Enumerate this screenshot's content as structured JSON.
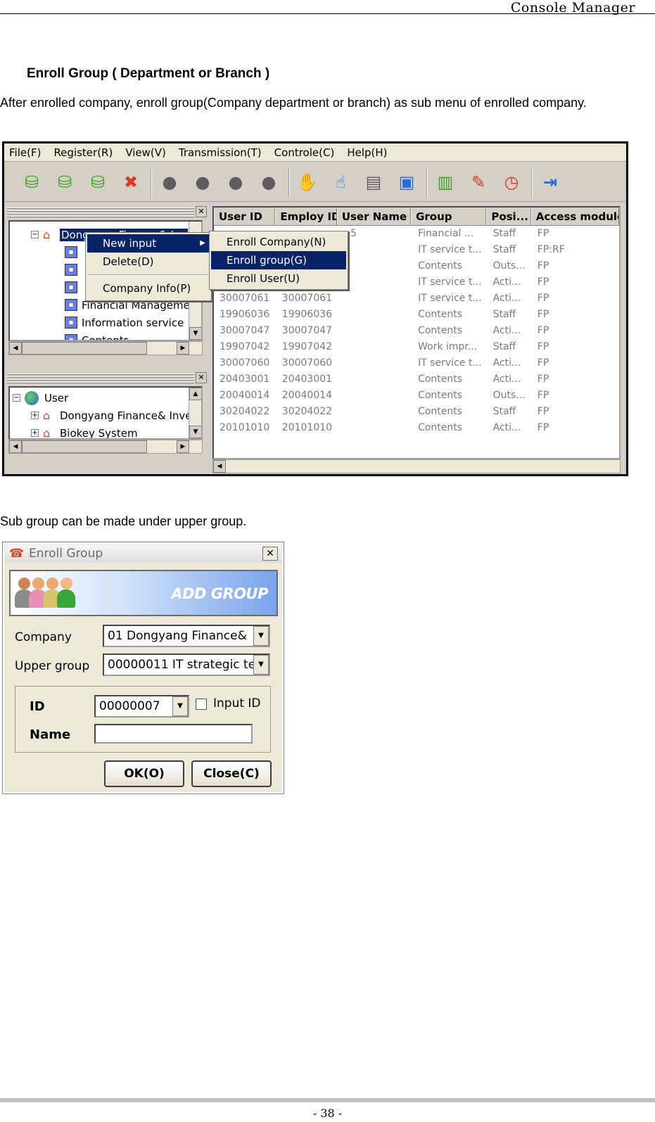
{
  "header": {
    "title": "Console Manager"
  },
  "section": {
    "heading": "Enroll Group ( Department or Branch )",
    "intro": "After enrolled company, enroll group(Company department or branch) as sub menu of enrolled company.",
    "subtext": "Sub group can be made under upper group."
  },
  "console": {
    "menu": [
      "File(F)",
      "Register(R)",
      "View(V)",
      "Transmission(T)",
      "Controle(C)",
      "Help(H)"
    ],
    "toolbar_icons": [
      "database-add-icon",
      "database-delete-icon",
      "database-info-icon",
      "delete-icon",
      "user-icon",
      "user-add-icon",
      "users-icon",
      "users-group-icon",
      "hand-icon",
      "finger-icon",
      "card-icon",
      "rf-icon",
      "monitor-icon",
      "edit-icon",
      "clock-icon",
      "exit-icon"
    ],
    "tree_top": {
      "rows": [
        "Dongyang Finance& Inv",
        "",
        "",
        "",
        "Financial Manageme",
        "Information service",
        "Contents"
      ]
    },
    "tree_bottom": {
      "rows": [
        "User",
        "Dongyang Finance& Inve",
        "Biokey System"
      ]
    },
    "grid": {
      "columns": [
        "User ID",
        "Employ ID",
        "User Name",
        "Group",
        "Posi...",
        "Access module"
      ],
      "rows": [
        [
          "",
          "",
          "e5",
          "Financial ...",
          "Staff",
          "FP"
        ],
        [
          "",
          "",
          "",
          "IT service t...",
          "Staff",
          "FP:RF"
        ],
        [
          "",
          "",
          "",
          "Contents",
          "Outs...",
          "FP"
        ],
        [
          "",
          "",
          "",
          "IT service t...",
          "Acti...",
          "FP"
        ],
        [
          "30007061",
          "30007061",
          "",
          "IT service t...",
          "Acti...",
          "FP"
        ],
        [
          "19906036",
          "19906036",
          "",
          "Contents",
          "Staff",
          "FP"
        ],
        [
          "30007047",
          "30007047",
          "",
          "Contents",
          "Acti...",
          "FP"
        ],
        [
          "19907042",
          "19907042",
          "",
          "Work impr...",
          "Staff",
          "FP"
        ],
        [
          "30007060",
          "30007060",
          "",
          "IT service t...",
          "Acti...",
          "FP"
        ],
        [
          "20403001",
          "20403001",
          "",
          "Contents",
          "Acti...",
          "FP"
        ],
        [
          "20040014",
          "20040014",
          "",
          "Contents",
          "Outs...",
          "FP"
        ],
        [
          "30204022",
          "30204022",
          "",
          "Contents",
          "Staff",
          "FP"
        ],
        [
          "20101010",
          "20101010",
          "",
          "Contents",
          "Acti...",
          "FP"
        ]
      ]
    },
    "context_menu": {
      "new_input": "New input",
      "delete": "Delete(D)",
      "company_info": "Company Info(P)"
    },
    "submenu": {
      "enroll_company": "Enroll Company(N)",
      "enroll_group": "Enroll group(G)",
      "enroll_user": "Enroll User(U)"
    }
  },
  "dialog": {
    "title": "Enroll Group",
    "banner": "ADD GROUP",
    "company_label": "Company",
    "company_value": "01 Dongyang Finance&",
    "upper_group_label": "Upper group",
    "upper_group_value": "00000011 IT strategic te",
    "id_label": "ID",
    "id_value": "00000007",
    "input_id_label": "Input ID",
    "input_id_checked": false,
    "name_label": "Name",
    "name_value": "",
    "ok_label": "OK(O)",
    "close_label": "Close(C)"
  },
  "footer": {
    "page": "- 38 -"
  }
}
